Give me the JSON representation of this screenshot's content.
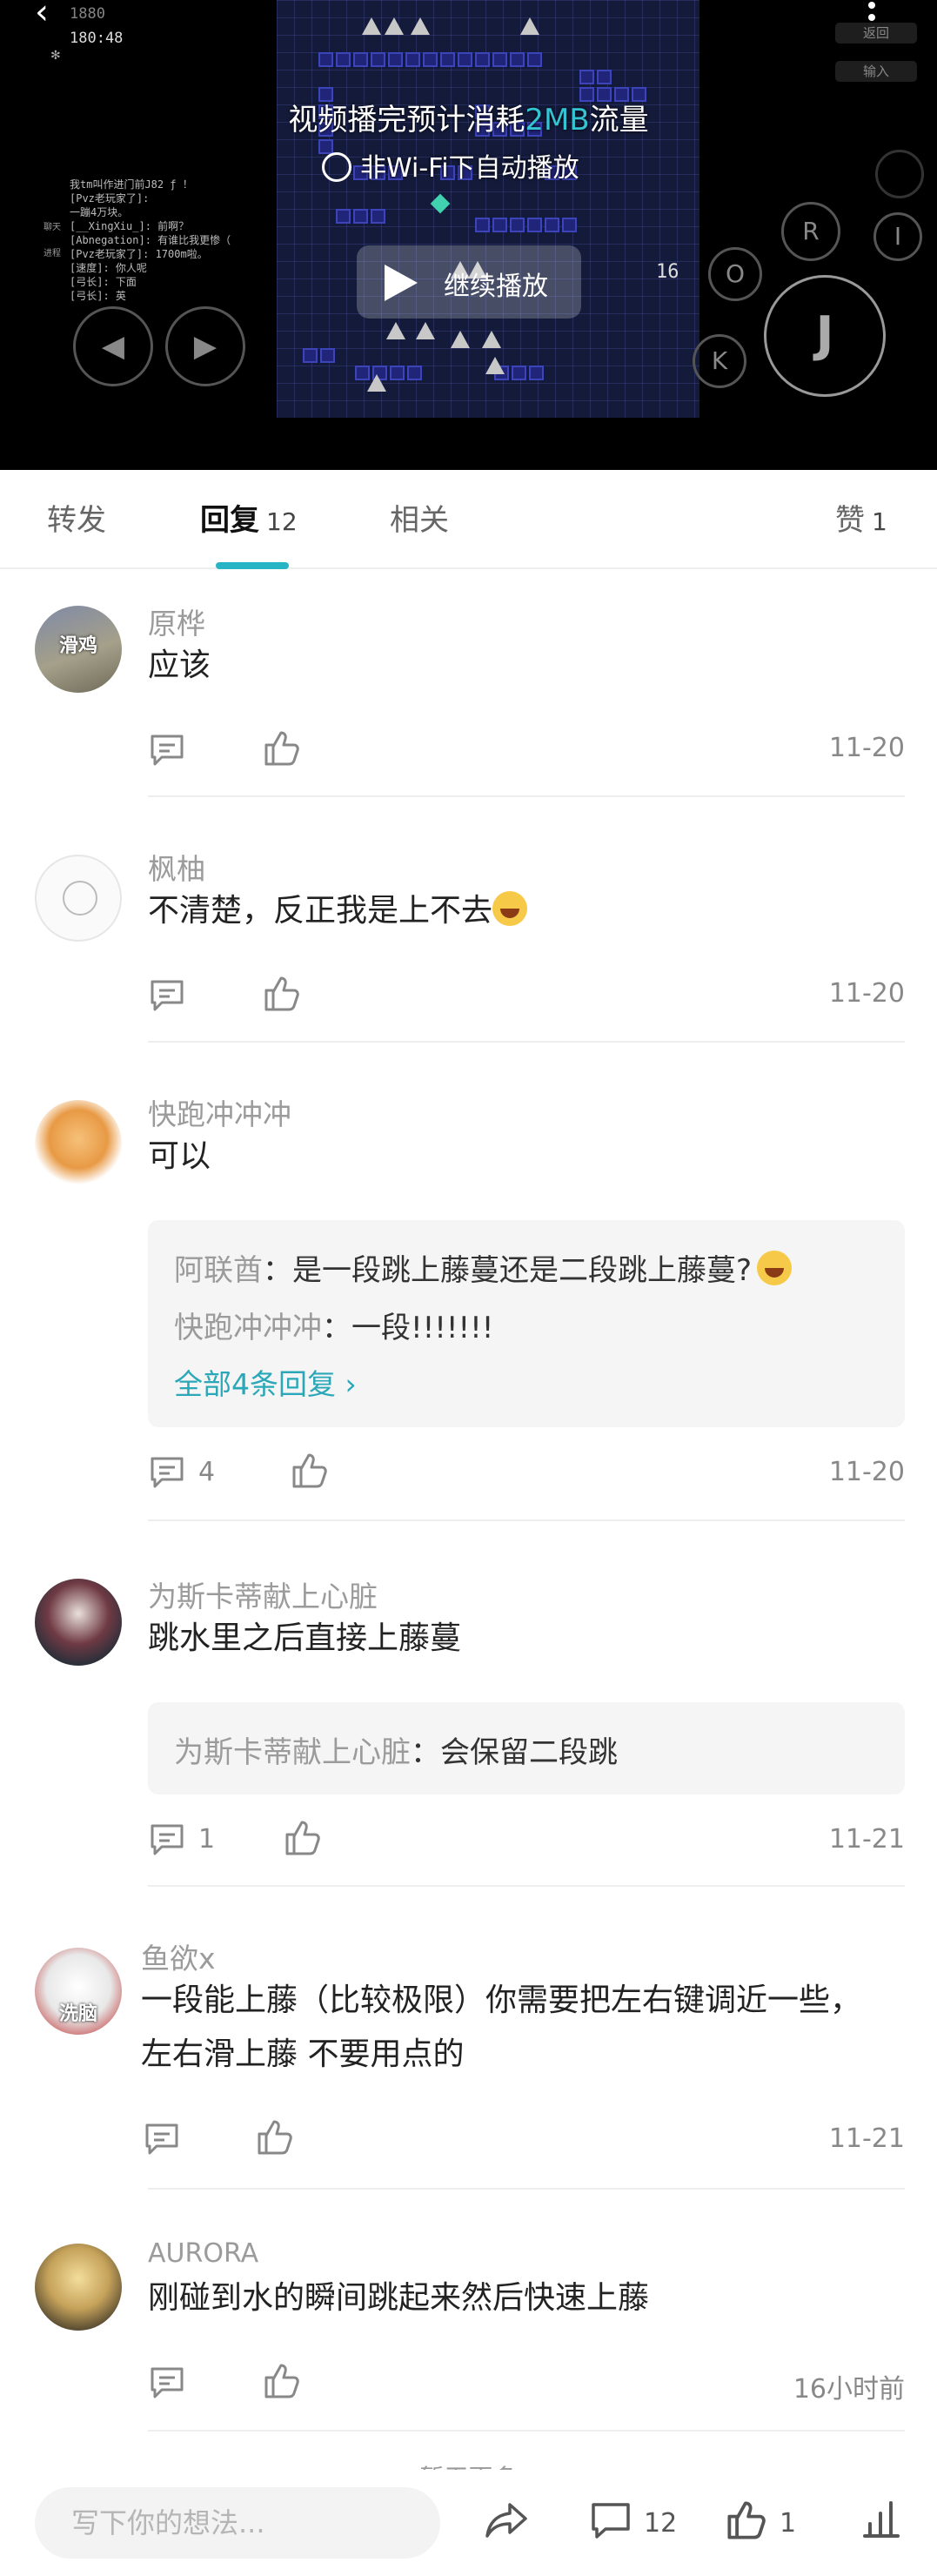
{
  "video": {
    "overlay_top_num": "1880",
    "overlay_time": "180:48",
    "side_buttons": [
      "返回",
      "输入"
    ],
    "log_lines": [
      "我tm叫作进门前J82 ƒ ！",
      "[Pvz老玩家了]:",
      "一蹦4万块。",
      "[__XingXiu_]: 前啊？",
      "[Abnegation]: 有谁比我更惨（",
      "[Pvz老玩家了]: 1700m啦。",
      "[速度]: 你人呢",
      "[弓长]: 下面",
      "[弓长]: 英"
    ],
    "log_side_labels": [
      "聊天",
      "进程"
    ],
    "game_number": "16",
    "notice_prefix": "视频播完预计消耗",
    "notice_size": "2MB",
    "notice_suffix": "流量",
    "autoplay_label": "非Wi-Fi下自动播放",
    "play_label": "继续播放",
    "controls": {
      "r": "R",
      "i": "I",
      "o": "O",
      "k": "K",
      "j": "J"
    }
  },
  "tabs": [
    {
      "label": "转发",
      "count": ""
    },
    {
      "label": "回复",
      "count": "12"
    },
    {
      "label": "相关",
      "count": ""
    },
    {
      "label": "赞",
      "count": "1"
    }
  ],
  "comments": [
    {
      "user": "原桦",
      "avatar_text": "滑鸡",
      "text": "应该",
      "reply_count": "",
      "date": "11-20"
    },
    {
      "user": "枫柚",
      "avatar_text": "",
      "text": "不清楚，反正我是上不去",
      "reply_count": "",
      "date": "11-20"
    },
    {
      "user": "快跑冲冲冲",
      "avatar_text": "",
      "text": "可以",
      "reply_count": "4",
      "date": "11-20",
      "replies": [
        {
          "name": "阿联酋",
          "text": "：是一段跳上藤蔓还是二段跳上藤蔓?"
        },
        {
          "name": "快跑冲冲冲",
          "text": "：一段!!!!!!!"
        }
      ],
      "more": "全部4条回复"
    },
    {
      "user": "为斯卡蒂献上心脏",
      "avatar_text": "",
      "text": "跳水里之后直接上藤蔓",
      "reply_count": "1",
      "date": "11-21",
      "replies": [
        {
          "name": "为斯卡蒂献上心脏",
          "text": "：会保留二段跳"
        }
      ]
    },
    {
      "user": "鱼欲x",
      "avatar_text": "洗脑",
      "text_line1": "一段能上藤（比较极限）你需要把左右键调近一些，",
      "text_line2": "左右滑上藤 不要用点的",
      "reply_count": "",
      "date": "11-21"
    },
    {
      "user": "AURORA",
      "avatar_text": "",
      "text": "刚碰到水的瞬间跳起来然后快速上藤",
      "reply_count": "",
      "date": "16小时前"
    }
  ],
  "load_more": "暂无更多",
  "bottom": {
    "placeholder": "写下你的想法...",
    "comment_count": "12",
    "like_count": "1"
  },
  "colors": {
    "accent": "#27b4c4",
    "link": "#2aa7b8",
    "muted": "#9b9b9b"
  }
}
